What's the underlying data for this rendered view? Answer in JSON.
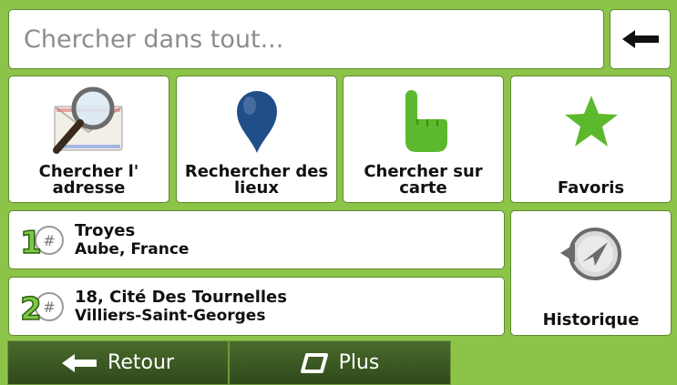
{
  "search": {
    "placeholder": "Chercher dans tout..."
  },
  "keyboard": {
    "backspace_icon": "backspace-arrow-icon"
  },
  "categories": [
    {
      "label": "Chercher l' adresse",
      "icon": "magnifier-envelope-icon"
    },
    {
      "label": "Rechercher des lieux",
      "icon": "map-pin-icon"
    },
    {
      "label": "Chercher sur carte",
      "icon": "pointing-hand-icon"
    },
    {
      "label": "Favoris",
      "icon": "star-icon"
    }
  ],
  "recent": [
    {
      "number": "1",
      "title": "Troyes",
      "subtitle": "Aube, France"
    },
    {
      "number": "2",
      "title": "18, Cité Des Tournelles",
      "subtitle": "Villiers-Saint-Georges"
    }
  ],
  "history_button": {
    "label": "Historique",
    "icon": "history-icon"
  },
  "bottom_bar": {
    "back_label": "Retour",
    "more_label": "Plus"
  },
  "colors": {
    "background": "#8cc44a",
    "accent_green": "#5cb82c",
    "pin_blue": "#1f4e89"
  }
}
